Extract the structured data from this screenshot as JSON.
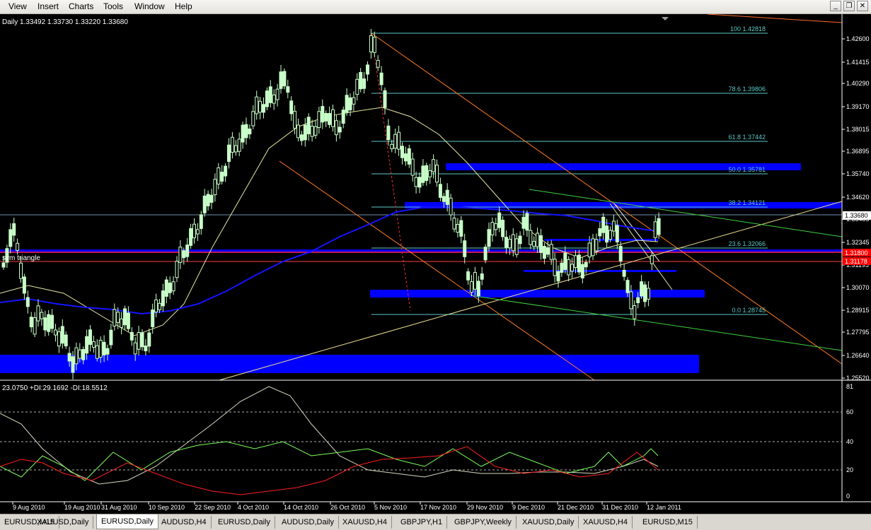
{
  "menu": [
    "View",
    "Insert",
    "Charts",
    "Tools",
    "Window",
    "Help"
  ],
  "window_controls": {
    "minimize": "_",
    "restore": "❐",
    "close": "✕"
  },
  "chart": {
    "info": "Daily  1.33492 1.33730 1.33220 1.33680",
    "triangle_label": "sym triangle",
    "price_ticks": [
      "1.42600",
      "1.41415",
      "1.40290",
      "1.39170",
      "1.38015",
      "1.36895",
      "1.35740",
      "1.34620",
      "1.33485",
      "1.32345",
      "1.31195",
      "1.30070",
      "1.28915",
      "1.27795",
      "1.26640",
      "1.25520"
    ],
    "current_price": "1.33680",
    "red_level_1": "1.31800",
    "red_level_2": "1.31178",
    "fib_levels": [
      {
        "label": "100  1.42818"
      },
      {
        "label": "78.6  1.39806"
      },
      {
        "label": "61.8  1.37442"
      },
      {
        "label": "50.0  1.35781"
      },
      {
        "label": "38.2  1.34121"
      },
      {
        "label": "23.6  1.32066"
      },
      {
        "label": "0.0  1.28745"
      }
    ],
    "indicator_info": "23.0750 +DI:29.1692 -DI:18.5512",
    "indicator_ticks": [
      "81",
      "60",
      "40",
      "20",
      "0"
    ],
    "date_ticks": [
      "9 Aug 2010",
      "19 Aug 2010",
      "31 Aug 2010",
      "10 Sep 2010",
      "22 Sep 2010",
      "4 Oct 2010",
      "14 Oct 2010",
      "26 Oct 2010",
      "5 Nov 2010",
      "17 Nov 2010",
      "29 Nov 2010",
      "9 Dec 2010",
      "21 Dec 2010",
      "31 Dec 2010",
      "12 Jan 2011"
    ],
    "colors": {
      "candle": "#c8ffc8",
      "fib": "#5ec8c8",
      "zone": "#0000ff",
      "ma_fast": "#e8e8a0",
      "ma_slow": "#1414ff",
      "adx": "#d8d8c0",
      "plus_di": "#7cff5c",
      "minus_di": "#ff2020"
    }
  },
  "tabs": [
    "EURUSD,M15",
    "XAUUSD,Daily",
    "EURUSD,Daily",
    "AUDUSD,H4",
    "EURUSD,Daily",
    "AUDUSD,Daily",
    "XAUUSD,H4",
    "GBPJPY,H1",
    "GBPJPY,Weekly",
    "XAUUSD,Daily",
    "XAUUSD,H4",
    "EURUSD,M15"
  ],
  "active_tab": "EURUSD,Daily"
}
